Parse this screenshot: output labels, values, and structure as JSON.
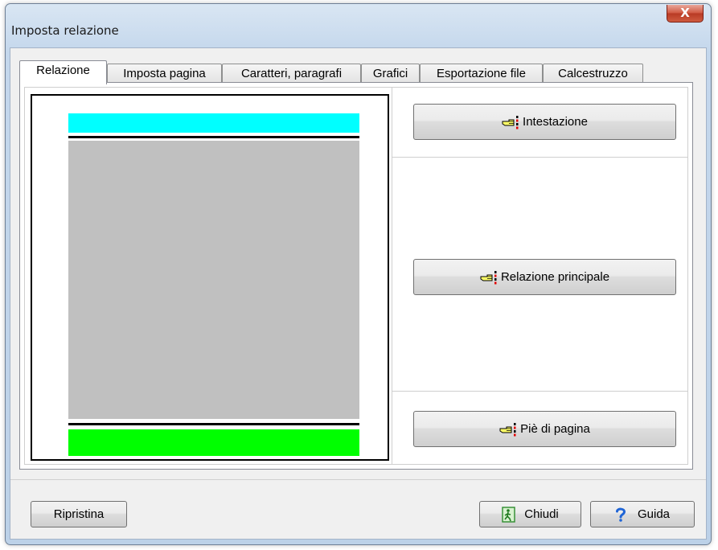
{
  "window": {
    "title": "Imposta relazione",
    "close_symbol": "X"
  },
  "tabs": [
    {
      "label": "Relazione",
      "active": true
    },
    {
      "label": "Imposta pagina",
      "active": false
    },
    {
      "label": "Caratteri, paragrafi",
      "active": false
    },
    {
      "label": "Grafici",
      "active": false
    },
    {
      "label": "Esportazione file",
      "active": false
    },
    {
      "label": "Calcestruzzo",
      "active": false
    }
  ],
  "preview": {
    "header_color": "#00ffff",
    "body_color": "#c0c0c0",
    "footer_color": "#00ff00"
  },
  "sections": {
    "header_button": {
      "label": "Intestazione",
      "icon": "pointing-hand-icon"
    },
    "main_button": {
      "label": "Relazione principale",
      "icon": "pointing-hand-icon"
    },
    "footer_button": {
      "label": "Piè di pagina",
      "icon": "pointing-hand-icon"
    }
  },
  "footer": {
    "reset_label": "Ripristina",
    "close_label": "Chiudi",
    "close_icon": "exit-door-icon",
    "help_label": "Guida",
    "help_icon": "question-mark-icon"
  }
}
